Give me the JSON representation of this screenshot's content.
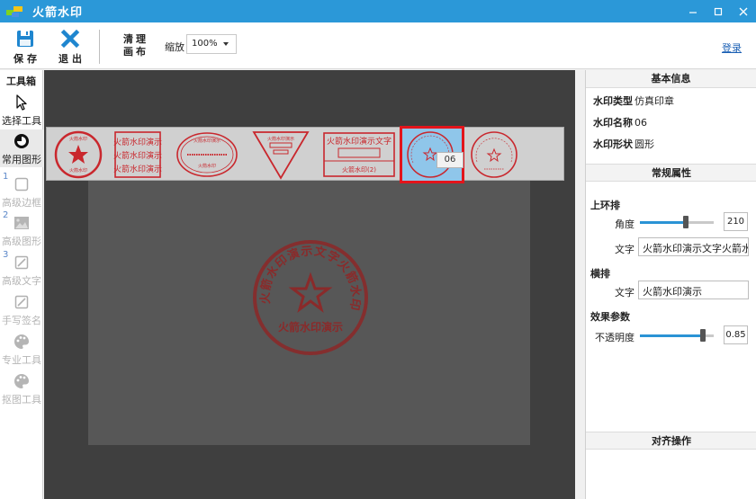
{
  "app": {
    "title": "火箭水印"
  },
  "window": {
    "min_icon": "minimize-icon",
    "max_icon": "maximize-icon",
    "close_icon": "close-icon"
  },
  "toolbar": {
    "save_label": "保存",
    "exit_label": "退出",
    "clear_line1": "清理",
    "clear_line2": "画布",
    "zoom_label": "缩放",
    "zoom_value": "100%",
    "login_label": "登录"
  },
  "toolbox": {
    "title": "工具箱",
    "items": [
      {
        "label": "选择工具",
        "icon": "cursor-icon"
      },
      {
        "label": "常用图形",
        "icon": "shape-icon"
      },
      {
        "num": "1",
        "label": "高级边框",
        "icon": "square-icon"
      },
      {
        "num": "2",
        "label": "高级图形",
        "icon": "image-icon"
      },
      {
        "num": "3",
        "label": "高级文字",
        "icon": "edit-icon"
      },
      {
        "label": "手写签名",
        "icon": "edit-icon"
      },
      {
        "label": "专业工具",
        "icon": "palette-icon"
      },
      {
        "label": "抠图工具",
        "icon": "palette-icon"
      }
    ]
  },
  "stamps": {
    "tooltip": "06",
    "selected_index": 5,
    "preview_text": "火箭水印演示文字",
    "preview_bottom": "火箭水印(2)",
    "line_text": "火箭水印演示",
    "small_text": "火箭水印",
    "circle_top": "火箭水印演示文字火箭水印",
    "small_caption": "火箭水印演示",
    "mini_caption": "火箭水印(2)",
    "stamp_color": "#c9272d"
  },
  "canvas_stamp": {
    "ring_text": "火箭水印演示文字火箭水印",
    "bottom_text": "火箭水印演示",
    "color": "#8a2a2a"
  },
  "props": {
    "basic_title": "基本信息",
    "info": [
      {
        "key": "水印类型",
        "value": "仿真印章"
      },
      {
        "key": "水印名称",
        "value": "06"
      },
      {
        "key": "水印形状",
        "value": "圆形"
      }
    ],
    "general_title": "常规属性",
    "top_ring_title": "上环排",
    "angle_label": "角度",
    "angle_value": "210",
    "angle_fraction": 0.62,
    "top_text_label": "文字",
    "top_text_value": "火箭水印演示文字火箭水印",
    "horiz_title": "横排",
    "horiz_text_label": "文字",
    "horiz_text_value": "火箭水印演示",
    "effect_title": "效果参数",
    "opacity_label": "不透明度",
    "opacity_value": "0.85",
    "opacity_fraction": 0.85,
    "align_title": "对齐操作",
    "accent": "#2a93d5"
  }
}
